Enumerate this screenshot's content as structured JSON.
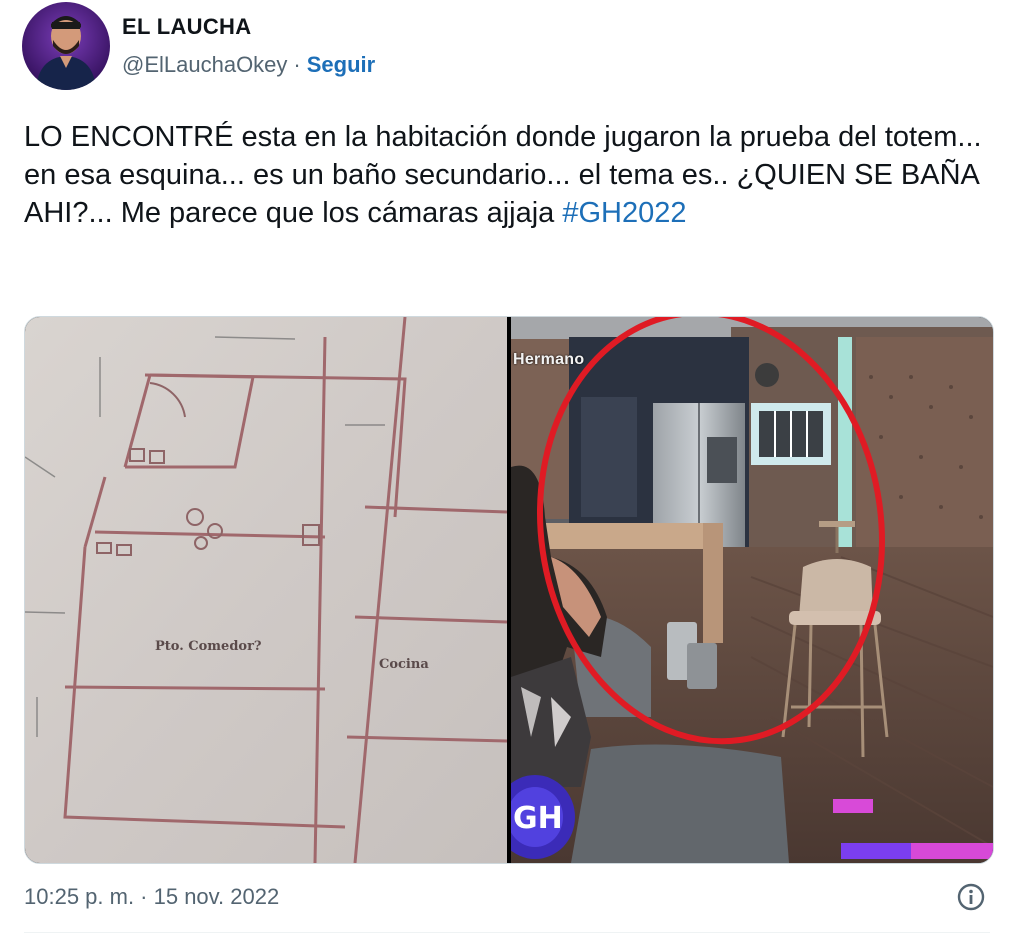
{
  "author": {
    "name": "EL LAUCHA",
    "handle": "@ElLauchaOkey",
    "separator": "·",
    "follow_label": "Seguir"
  },
  "tweet": {
    "text_main": "LO ENCONTRÉ esta en la habitación donde jugaron la prueba del totem... en esa esquina... es un baño secundario... el tema es.. ¿QUIEN SE BAÑA AHI?... Me parece que los cámaras ajjaja ",
    "hashtag": "#GH2022"
  },
  "media": {
    "left_image": {
      "labels": {
        "room_main": "Pto. Comedor?",
        "room_side": "Cocina"
      }
    },
    "right_image": {
      "overlay_label": "Hermano",
      "logo_text": "GH",
      "circle_color": "#e01b24"
    }
  },
  "footer": {
    "timestamp": "10:25 p. m. · 15 nov. 2022"
  },
  "colors": {
    "link": "#1d6fb8",
    "muted": "#536471",
    "text": "#0f1419"
  },
  "icons": {
    "info": "info-circle-icon"
  }
}
